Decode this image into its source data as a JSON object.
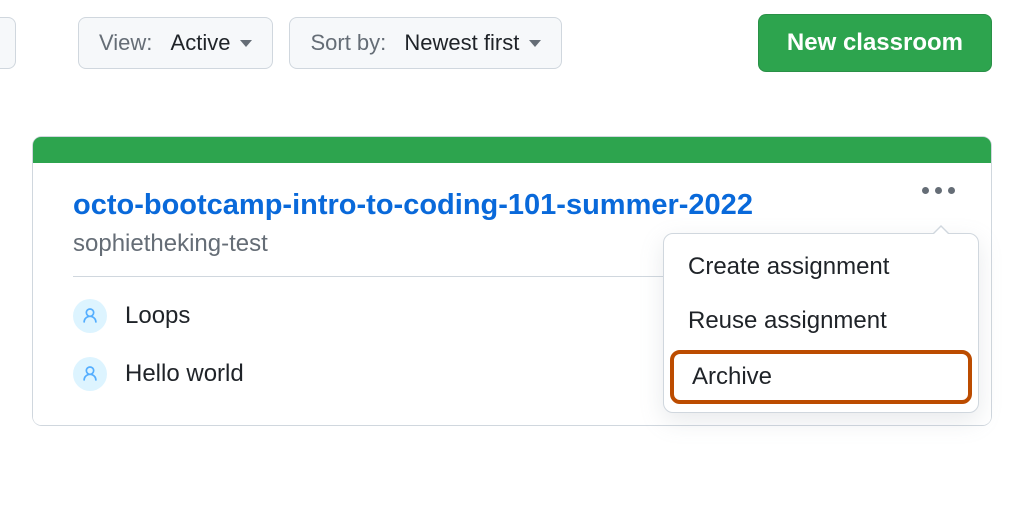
{
  "toolbar": {
    "view": {
      "label": "View:",
      "value": "Active"
    },
    "sort": {
      "label": "Sort by:",
      "value": "Newest first"
    },
    "new_classroom_label": "New classroom"
  },
  "classroom": {
    "title": "octo-bootcamp-intro-to-coding-101-summer-2022",
    "subtitle": "sophietheking-test",
    "assignments": [
      {
        "name": "Loops"
      },
      {
        "name": "Hello world"
      }
    ],
    "menu": {
      "items": [
        {
          "label": "Create assignment",
          "highlighted": false
        },
        {
          "label": "Reuse assignment",
          "highlighted": false
        },
        {
          "label": "Archive",
          "highlighted": true
        }
      ]
    }
  }
}
